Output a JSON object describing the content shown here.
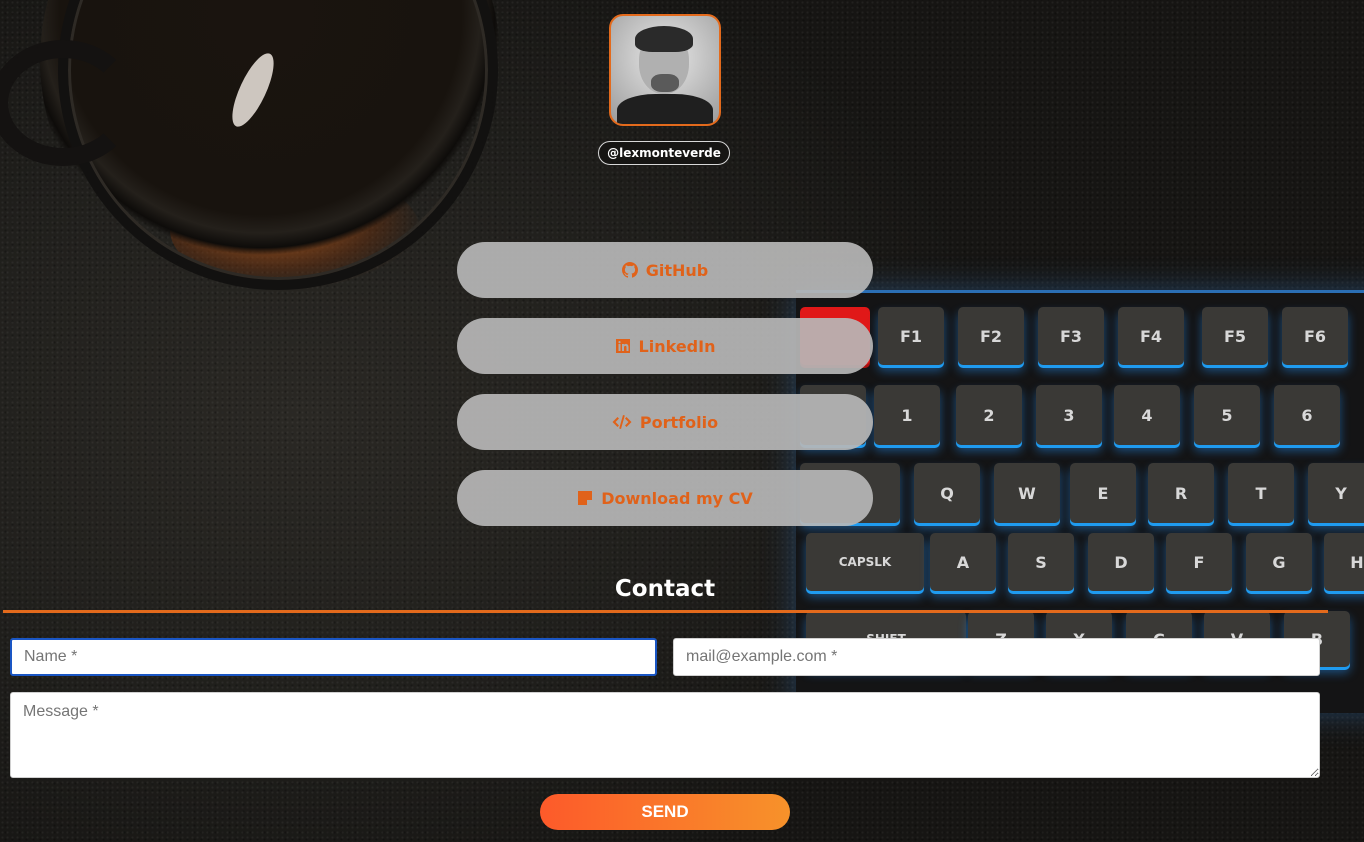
{
  "profile": {
    "handle": "@lexmonteverde"
  },
  "links": [
    {
      "label": "GitHub",
      "icon": "github-icon"
    },
    {
      "label": "LinkedIn",
      "icon": "linkedin-icon"
    },
    {
      "label": "Portfolio",
      "icon": "code-icon"
    },
    {
      "label": "Download my CV",
      "icon": "document-icon"
    }
  ],
  "contact": {
    "title": "Contact",
    "name_placeholder": "Name *",
    "email_placeholder": "mail@example.com *",
    "message_placeholder": "Message *",
    "send_label": "SEND"
  },
  "background": {
    "keys": {
      "f1": "F1",
      "f2": "F2",
      "f3": "F3",
      "f4": "F4",
      "f5": "F5",
      "f6": "F6",
      "n1": "1",
      "n2": "2",
      "n3": "3",
      "n4": "4",
      "n5": "5",
      "n6": "6",
      "q": "Q",
      "w": "W",
      "e": "E",
      "r": "R",
      "t": "T",
      "y": "Y",
      "caps": "CAPSLK",
      "a": "A",
      "s": "S",
      "d": "D",
      "f": "F",
      "g": "G",
      "h": "H",
      "shift": "SHIFT",
      "z": "Z",
      "x": "X",
      "c": "C",
      "v": "V",
      "b": "B"
    }
  },
  "colors": {
    "accent": "#e36a1c",
    "link_text": "#e0621a",
    "button_bg": "#b7b7b7",
    "send_gradient_start": "#fd5a2a",
    "send_gradient_end": "#f7922a"
  }
}
